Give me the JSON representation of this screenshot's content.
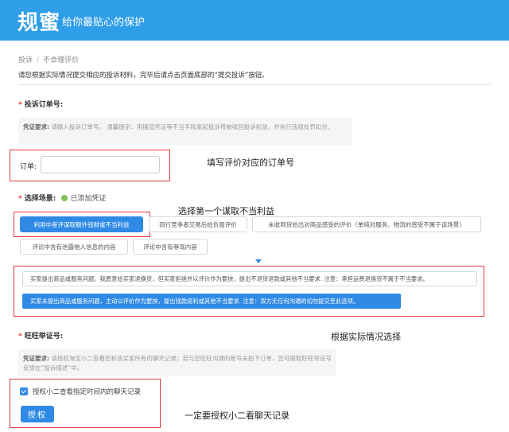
{
  "header": {
    "logo": "规蜜",
    "slogan": "给你最贴心的保护"
  },
  "breadcrumb": {
    "items": [
      "投诉",
      "不合理评价"
    ],
    "separator": "/"
  },
  "instruction": "请您根据实际情况提交相应的投诉材料，完毕后请点击页面底部的“提交投诉”按钮。",
  "order_section": {
    "required_mark": "*",
    "title": "投诉订单号:",
    "notice_label": "凭证要求:",
    "notice_text": "请输入投诉订单号。 温馨提示：用擅造凭证等不当手段发起投诉将被收回投诉权益，并执行违规处罚扣分。",
    "input_label": "订单:",
    "input_value": "",
    "annotation": "填写评价对应的订单号"
  },
  "scene_section": {
    "required_mark": "*",
    "title": "选择场景:",
    "added_label": "已添加凭证",
    "annotation": "选择第一个谋取不当利益",
    "chips": [
      {
        "label": "利用中差评谋取额外钱财或不当利益",
        "active": true
      },
      {
        "label": "同行竞争者交易后给负面评价",
        "active": false
      },
      {
        "label": "未收到货给出对商品感受的评价（单纯对服务、物流的感受不属于该场景）",
        "active": false
      },
      {
        "label": "评论中含有泄露他人信息的内容",
        "active": false
      },
      {
        "label": "评论中含有辱骂内容",
        "active": false
      }
    ],
    "sub_options": [
      {
        "label": "买家提出商品或服务问题，我愿意给买家退换货，但买家拒绝并以评价作为要挟，提出不退货退款或其他不当要求. 注意：承担运费退换货不属于不当要求。",
        "active": false
      },
      {
        "label": "买家未提出商品或服务问题，主动以评价作为要挟，提出钱款返利或其他不当要求. 注意：双方无任何沟通的切勿提交至此选项。",
        "active": true
      }
    ],
    "sub_annotation": "根据实际情况选择"
  },
  "wangwang_section": {
    "required_mark": "*",
    "title": "旺旺举证号:",
    "notice_label": "凭证要求:",
    "notice_text": "请授权淘宝小二查看您和该买家所有的聊天记录；若与您旺旺沟通的账号未拍下订单，您可提取旺旺举证号反馈在“投诉描述”中。",
    "checkbox_label": "授权小二查看指定时间内的聊天记录",
    "checkbox_checked": true,
    "button_label": "授权",
    "annotation": "一定要授权小二看聊天记录"
  },
  "colors": {
    "header_bg": "#2f9ee8",
    "primary": "#2f8ae5",
    "highlight_border": "#e33b3b",
    "required": "#e4393c",
    "added_dot": "#7fc25b"
  },
  "icons": {
    "added": "green-dot-icon",
    "checkbox": "checkmark-icon",
    "dropdown": "caret-down-icon"
  }
}
